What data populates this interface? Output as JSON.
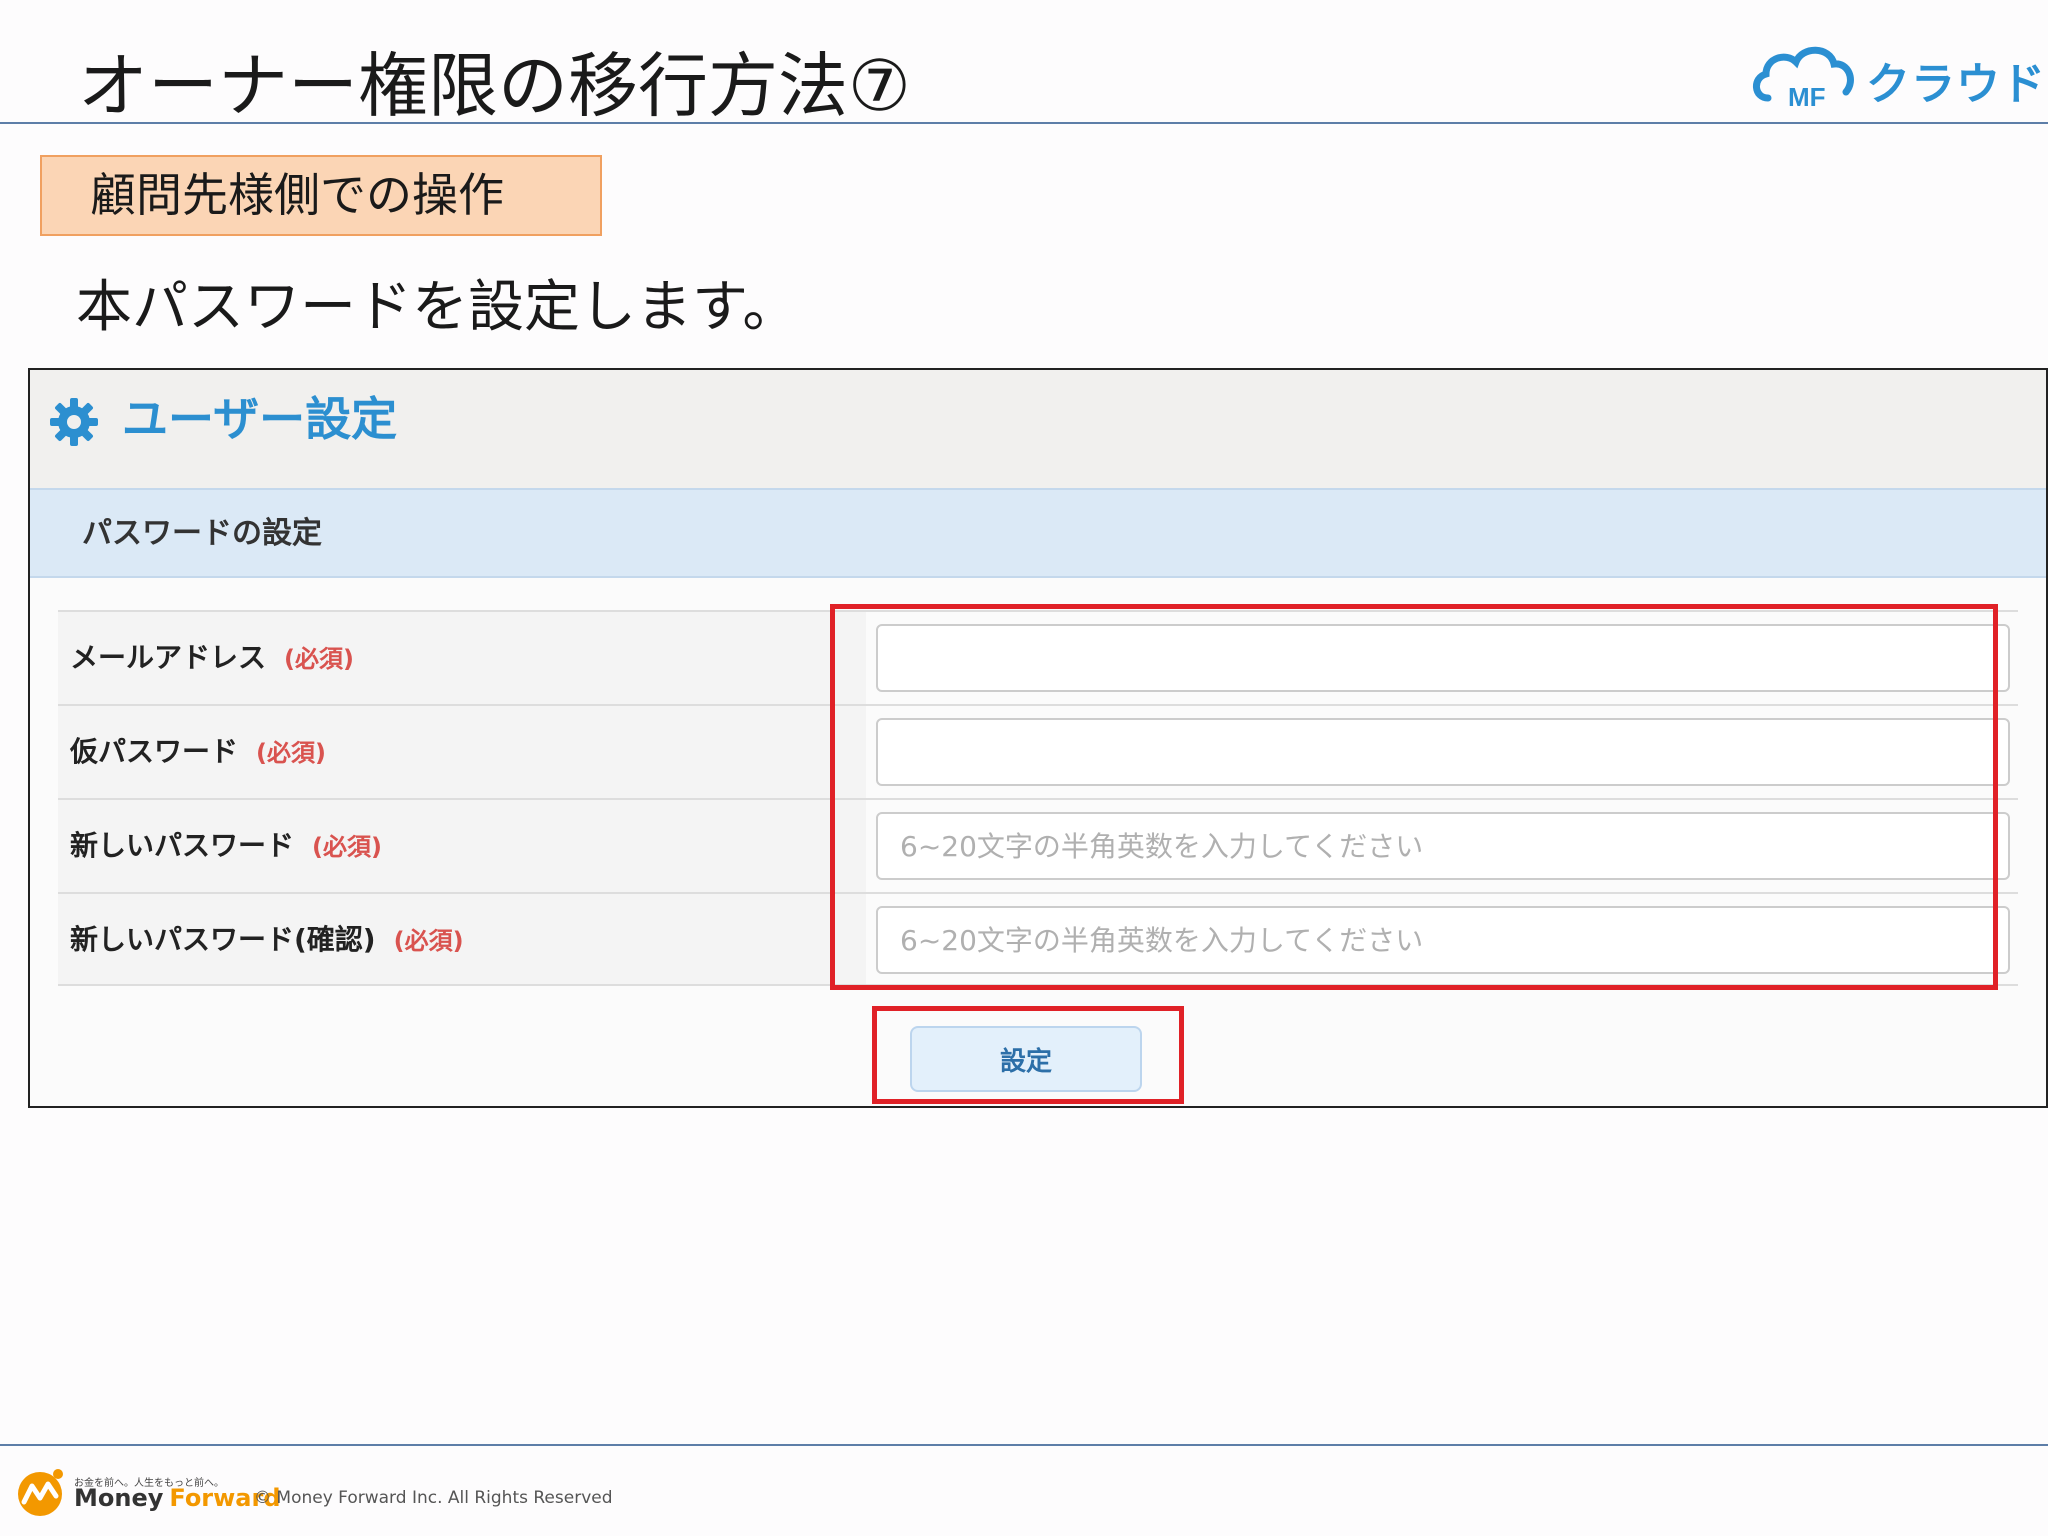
{
  "slide": {
    "title": "オーナー権限の移行方法⑦",
    "brand": "クラウド",
    "brand_mark": "MF",
    "tag": "顧問先様側での操作",
    "instruction": "本パスワードを設定します。"
  },
  "panel": {
    "title": "ユーザー設定",
    "section": "パスワードの設定",
    "required_label": "(必須)",
    "fields": [
      {
        "label": "メールアドレス",
        "value": "",
        "placeholder": ""
      },
      {
        "label": "仮パスワード",
        "value": "",
        "placeholder": ""
      },
      {
        "label": "新しいパスワード",
        "value": "",
        "placeholder": "6~20文字の半角英数を入力してください"
      },
      {
        "label": "新しいパスワード(確認)",
        "value": "",
        "placeholder": "6~20文字の半角英数を入力してください"
      }
    ],
    "submit": "設定"
  },
  "footer": {
    "tagline": "お金を前へ。人生をもっと前へ。",
    "brand_left": "Money",
    "brand_right": "Forward",
    "copyright": "© Money Forward Inc. All Rights Reserved"
  },
  "colors": {
    "accent_blue": "#2c8fd0",
    "highlight_red": "#e02127",
    "tag_bg": "#fbd5b5",
    "section_bg": "#dbe9f6",
    "required_red": "#d9534f",
    "forward_orange": "#f39800"
  },
  "icons": [
    "cloud-icon",
    "gear-icon",
    "money-forward-logo-icon"
  ]
}
